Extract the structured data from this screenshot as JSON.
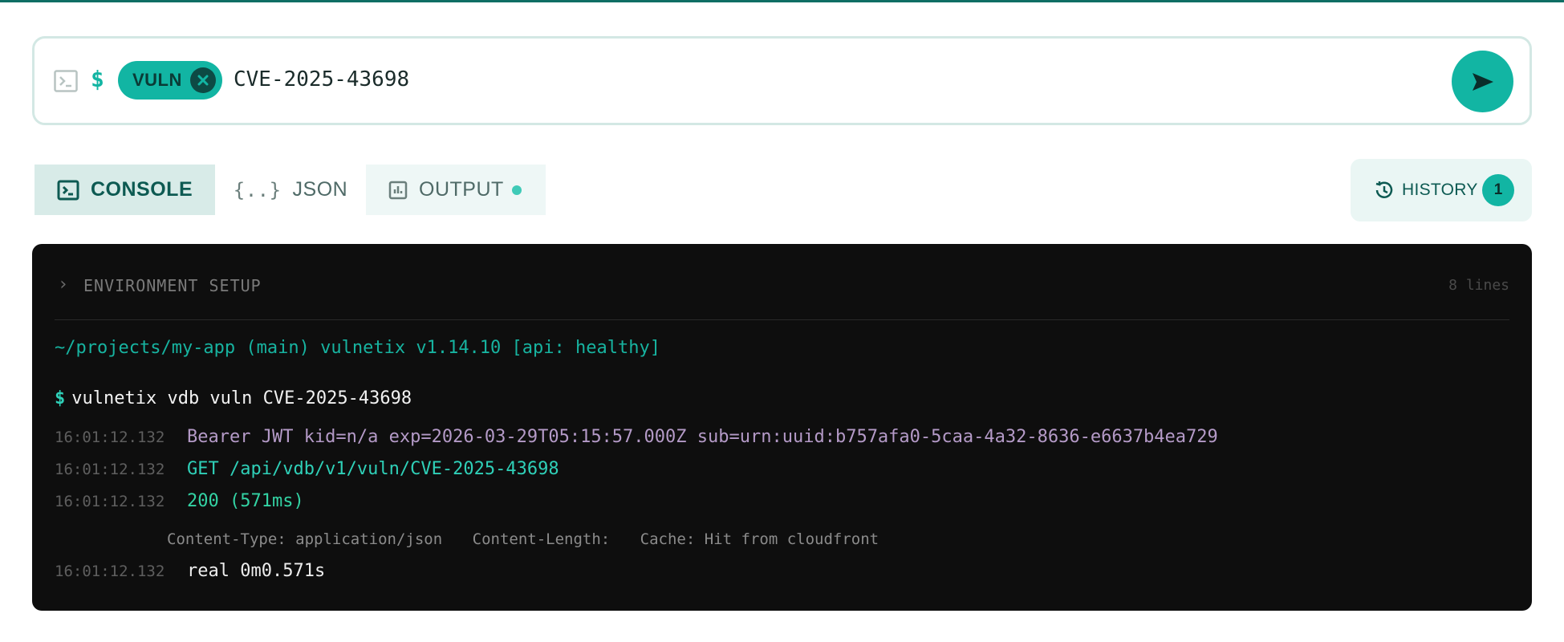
{
  "command_bar": {
    "prompt_symbol": "$",
    "chip_label": "VULN",
    "query": "CVE-2025-43698",
    "icons": [
      "terminal-icon",
      "close-icon",
      "send-icon"
    ]
  },
  "tabs": [
    {
      "label": "CONSOLE",
      "icon": "terminal-icon",
      "active": true
    },
    {
      "label": "JSON",
      "icon": "braces-icon",
      "active": false
    },
    {
      "label": "OUTPUT",
      "icon": "chart-icon",
      "active": false
    }
  ],
  "history": {
    "label": "HISTORY",
    "count": "1",
    "icon": "history-icon"
  },
  "console": {
    "env_label": "ENVIRONMENT SETUP",
    "env_count": "8 lines",
    "context_line": "~/projects/my-app (main) vulnetix v1.14.10 [api: healthy]",
    "command_symbol": "$",
    "command": "vulnetix vdb vuln CVE-2025-43698",
    "log": [
      {
        "time": "16:01:12.132",
        "text": "Bearer JWT kid=n/a exp=2026-03-29T05:15:57.000Z sub=urn:uuid:b757afa0-5caa-4a32-8636-e6637b4ea729"
      },
      {
        "time": "16:01:12.132",
        "text": "GET /api/vdb/v1/vuln/CVE-2025-43698"
      },
      {
        "time": "16:01:12.132",
        "text": "200 (571ms)"
      },
      {
        "time": "16:01:12.132",
        "text": "real 0m0.571s"
      }
    ],
    "headers": [
      "Content-Type: application/json",
      "Content-Length:",
      "Cache: Hit from cloudfront"
    ]
  },
  "colors": {
    "accent": "#12b5a3",
    "console_bg": "#0e0e0e",
    "brand_dark": "#0d5a52"
  }
}
